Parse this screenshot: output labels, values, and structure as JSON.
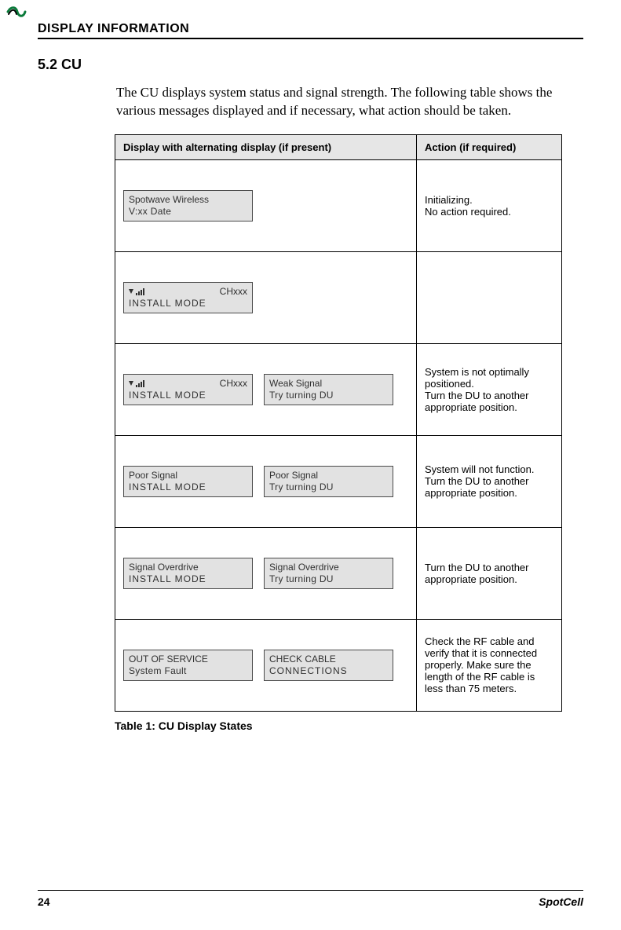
{
  "header": {
    "title_caps": "D",
    "title_rest": "ISPLAY ",
    "title_caps2": "I",
    "title_rest2": "NFORMATION",
    "full": "DISPLAY INFORMATION"
  },
  "section": {
    "heading": "5.2 CU",
    "body": "The CU displays system status and signal strength. The following table shows the various messages displayed and if necessary, what action should be taken."
  },
  "table": {
    "col_display": "Display with alternating display (if present)",
    "col_action": "Action (if required)",
    "caption": "Table 1:   CU Display States",
    "rows": [
      {
        "lcd1": {
          "line1_left": "Spotwave Wireless",
          "line1_right": "",
          "line2": "V:xx        Date",
          "signal": false,
          "wide2": false
        },
        "lcd2": null,
        "action": "Initializing.\nNo action required."
      },
      {
        "lcd1": {
          "line1_left": "",
          "line1_right": "CHxxx",
          "line2": "INSTALL MODE",
          "signal": true,
          "wide2": true
        },
        "lcd2": null,
        "action": ""
      },
      {
        "lcd1": {
          "line1_left": "",
          "line1_right": "CHxxx",
          "line2": "INSTALL MODE",
          "signal": true,
          "wide2": true
        },
        "lcd2": {
          "line1_left": "Weak Signal",
          "line1_right": "",
          "line2": "Try turning DU",
          "signal": false,
          "wide2": false
        },
        "action": "System is not optimally positioned.\nTurn the DU to another appropriate position."
      },
      {
        "lcd1": {
          "line1_left": "Poor Signal",
          "line1_right": "",
          "line2": "INSTALL MODE",
          "signal": false,
          "wide2": true
        },
        "lcd2": {
          "line1_left": "Poor Signal",
          "line1_right": "",
          "line2": "Try turning DU",
          "signal": false,
          "wide2": false
        },
        "action": "System will not function. Turn the DU to another appropriate position."
      },
      {
        "lcd1": {
          "line1_left": "Signal Overdrive",
          "line1_right": "",
          "line2": "INSTALL MODE",
          "signal": false,
          "wide2": true
        },
        "lcd2": {
          "line1_left": "Signal Overdrive",
          "line1_right": "",
          "line2": "Try turning DU",
          "signal": false,
          "wide2": false
        },
        "action": "Turn the DU to another appropriate position."
      },
      {
        "lcd1": {
          "line1_left": "OUT OF SERVICE",
          "line1_right": "",
          "line2": "System Fault",
          "signal": false,
          "wide2": false
        },
        "lcd2": {
          "line1_left": "CHECK CABLE",
          "line1_right": "",
          "line2": "CONNECTIONS",
          "signal": false,
          "wide2": true
        },
        "action": "Check the RF cable and verify that it is connected properly. Make sure the length of the RF cable is less than 75 meters."
      }
    ]
  },
  "footer": {
    "page": "24",
    "brand": "SpotCell"
  }
}
